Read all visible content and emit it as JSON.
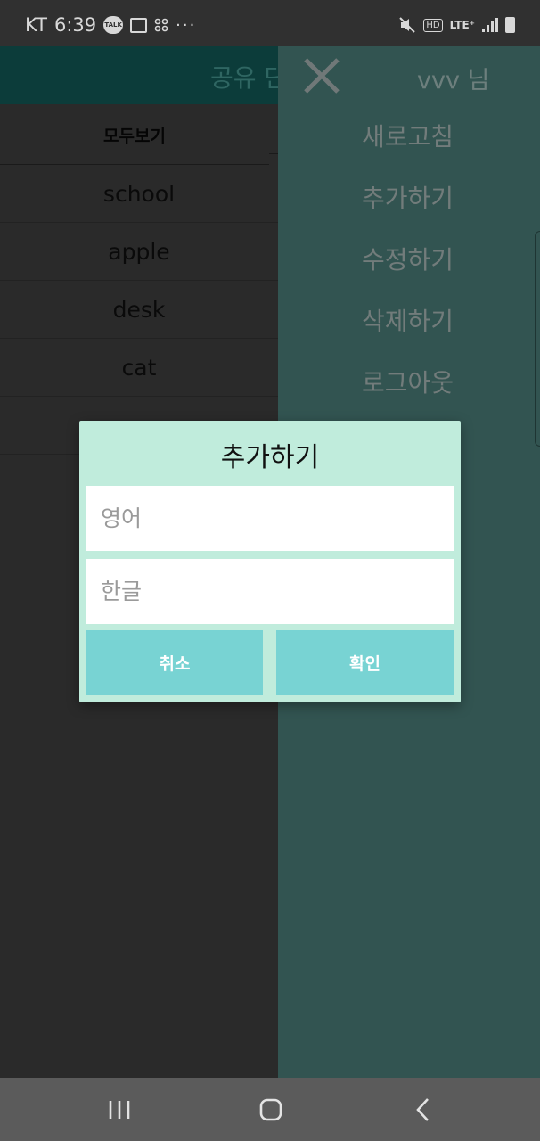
{
  "status_bar": {
    "carrier": "KT",
    "time": "6:39",
    "talk_badge": "TALK",
    "more": "···",
    "hd_label": "HD",
    "network": "LTE⁺"
  },
  "app": {
    "title": "공유 단",
    "tab_all": "모두보기",
    "words": [
      "school",
      "apple",
      "desk",
      "cat",
      ""
    ]
  },
  "drawer": {
    "user": "vvv 님",
    "menu": [
      "새로고침",
      "추가하기",
      "수정하기",
      "삭제하기",
      "로그아웃"
    ]
  },
  "dialog": {
    "title": "추가하기",
    "english_placeholder": "영어",
    "korean_placeholder": "한글",
    "cancel_label": "취소",
    "ok_label": "확인"
  },
  "colors": {
    "drawer_bg": "#325451",
    "dialog_bg": "#c0ecdc",
    "button_bg": "#78d3d3",
    "header_bg": "#0c3c3a"
  }
}
